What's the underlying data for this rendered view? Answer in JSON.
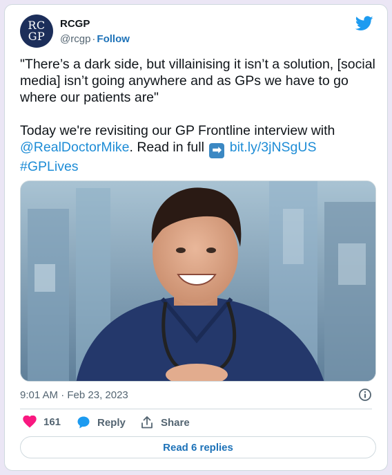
{
  "author": {
    "display_name": "RCGP",
    "handle": "@rcgp",
    "follow_label": "Follow",
    "avatar_text_top": "RC",
    "avatar_text_bottom": "GP"
  },
  "tweet": {
    "line1": "\"There’s a dark side, but villainising it isn’t a solution, [social media] isn’t going anywhere and as GPs we have to go where our patients are\"",
    "line2_prefix": "Today we're revisiting our GP Frontline interview with ",
    "mention": "@RealDoctorMike",
    "line2_middle": ". Read in full ",
    "arrow_emoji": "➡",
    "url": "bit.ly/3jNSgUS",
    "hashtag": "#GPLives"
  },
  "media": {
    "icon": "photo-of-doctor"
  },
  "meta": {
    "timestamp": "9:01 AM · Feb 23, 2023"
  },
  "actions": {
    "like_count": "161",
    "reply_label": "Reply",
    "share_label": "Share"
  },
  "footer": {
    "read_replies_label": "Read 6 replies"
  },
  "colors": {
    "link": "#1d8cd6",
    "twitter_blue": "#1d9bf0",
    "like": "#f91880",
    "avatar_bg": "#1c2e5a"
  }
}
